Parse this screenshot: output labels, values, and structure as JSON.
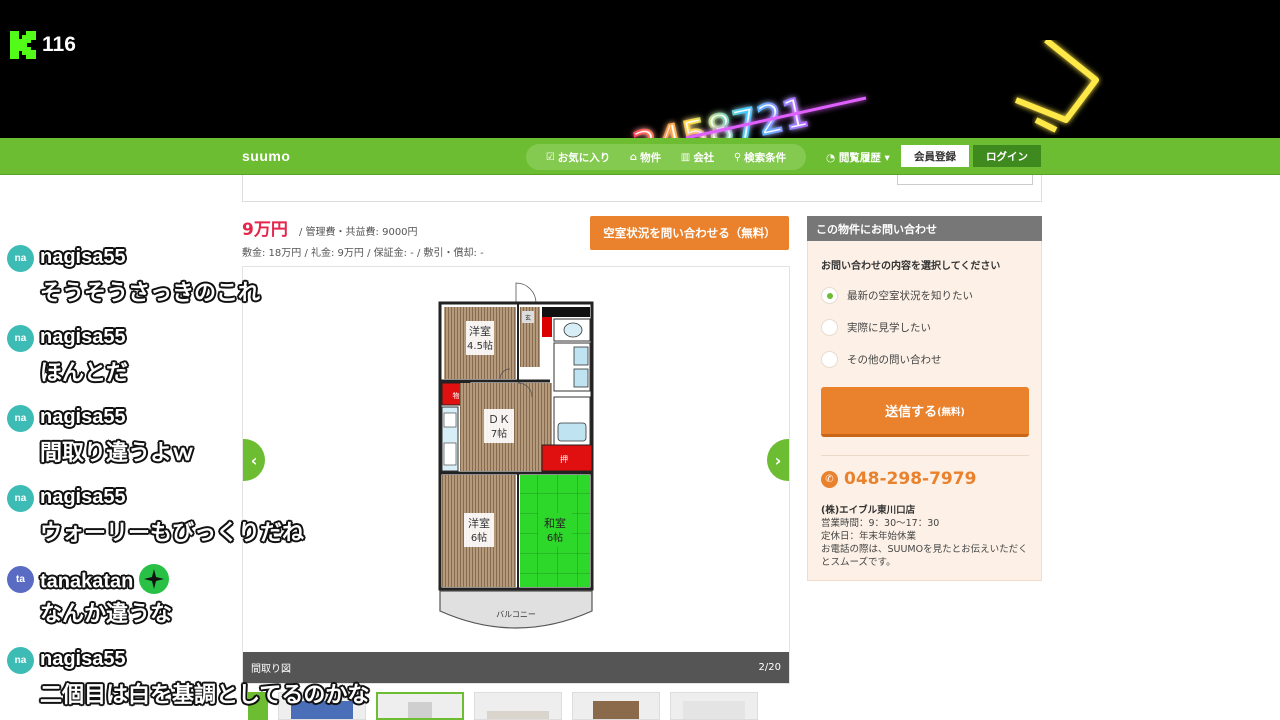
{
  "stream": {
    "viewer_count": "116",
    "neon_number": "3458721"
  },
  "header": {
    "logo": "suumo",
    "nav": [
      "お気に入り",
      "物件",
      "会社",
      "検索条件"
    ],
    "history": "閲覧履歴",
    "register": "会員登録",
    "login": "ログイン"
  },
  "property": {
    "price": "9万円",
    "mgmt_fee": "/ 管理費・共益費: 9000円",
    "fees_line": "敷金: 18万円 / 礼金: 9万円 / 保証金: - / 敷引・償却: -",
    "inquire_button": "空室状況を問い合わせる（無料）"
  },
  "gallery": {
    "caption": "間取り図",
    "counter": "2/20",
    "floorplan_labels": {
      "room1": "洋室",
      "room1_size": "4.5帖",
      "dk": "ＤＫ",
      "dk_size": "7帖",
      "room2": "洋室",
      "room2_size": "6帖",
      "washitsu": "和室",
      "washitsu_size": "6帖",
      "balcony": "バルコニー",
      "storage": "物",
      "genkan": "玄",
      "closet": "押"
    }
  },
  "inquiry": {
    "title": "この物件にお問い合わせ",
    "prompt": "お問い合わせの内容を選択してください",
    "options": [
      "最新の空室状況を知りたい",
      "実際に見学したい",
      "その他の問い合わせ"
    ],
    "submit": "送信する",
    "submit_note": "(無料)",
    "phone": "048-298-7979",
    "shop": "(株)エイブル東川口店",
    "hours": "営業時間：9：30～17：30",
    "holiday": "定休日：年末年始休業",
    "note": "お電話の際は、SUUMOを見たとお伝えいただくとスムーズです。"
  },
  "chat": [
    {
      "avatar": "na",
      "user": "nagisa55",
      "text": "そうそうさっきのこれ"
    },
    {
      "avatar": "na",
      "user": "nagisa55",
      "text": "ほんとだ"
    },
    {
      "avatar": "na",
      "user": "nagisa55",
      "text": "間取り違うよｗ"
    },
    {
      "avatar": "na",
      "user": "nagisa55",
      "text": "ウォーリーもびっくりだね"
    },
    {
      "avatar": "ta",
      "user": "tanakatan",
      "text": "なんか違うな"
    },
    {
      "avatar": "na",
      "user": "nagisa55",
      "text": "二個目は白を基調としてるのかな"
    }
  ],
  "colors": {
    "brand_green": "#6cbd32",
    "accent_orange": "#e9812d",
    "price_red": "#e3264b",
    "avatar_na": "#3cbcb4",
    "avatar_ta": "#5a6bc4"
  }
}
